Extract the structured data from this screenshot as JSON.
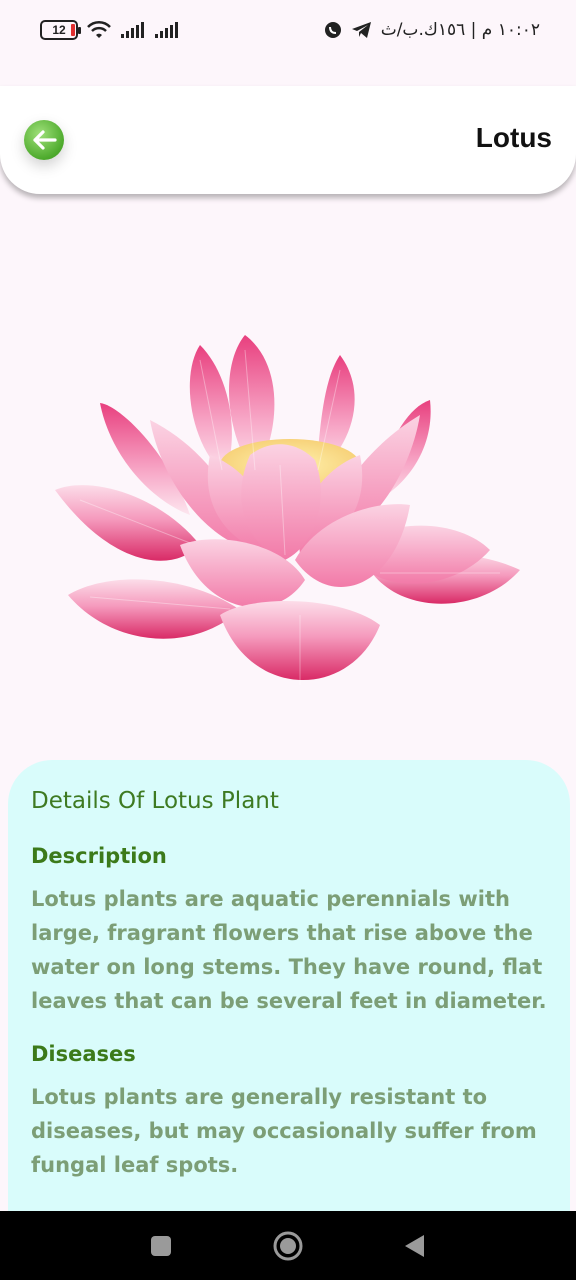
{
  "status_bar": {
    "battery_level": "12",
    "time_text": "١٠:٠٢ م | ١٥٦ك.ب/ث",
    "icons": [
      "battery-icon",
      "wifi-icon",
      "signal-icon",
      "signal-icon",
      "whatsapp-icon",
      "telegram-icon"
    ]
  },
  "header": {
    "title": "Lotus",
    "back_icon": "arrow-left-icon"
  },
  "image": {
    "subject": "pink lotus flower"
  },
  "details": {
    "title": "Details Of Lotus Plant",
    "sections": [
      {
        "heading": "Description",
        "text": "Lotus plants are aquatic perennials with large, fragrant flowers that rise above the water on long stems. They have round, flat leaves that can be several feet in diameter."
      },
      {
        "heading": "Diseases",
        "text": "Lotus plants are generally resistant to diseases, but may occasionally suffer from fungal leaf spots."
      }
    ]
  },
  "nav_bar": {
    "buttons": [
      "recent-apps-icon",
      "home-icon",
      "back-triangle-icon"
    ]
  },
  "colors": {
    "accent_green": "#4daa2c",
    "card_bg": "#d9fcfb",
    "heading_green": "#3c7a1a",
    "body_text": "#7c9e76",
    "page_bg": "#fdf6fb"
  }
}
